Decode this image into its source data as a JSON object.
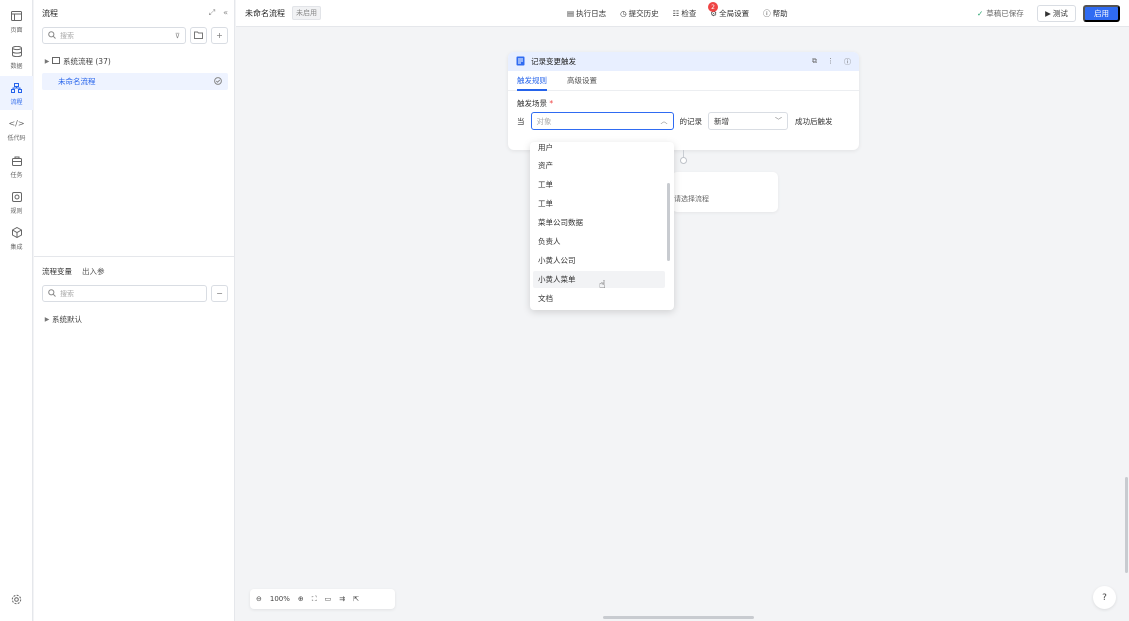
{
  "rail": {
    "items": [
      {
        "label": "页面",
        "icon": "page-icon"
      },
      {
        "label": "数据",
        "icon": "database-icon"
      },
      {
        "label": "流程",
        "icon": "flow-icon",
        "active": true
      },
      {
        "label": "低代码",
        "icon": "code-icon"
      },
      {
        "label": "任务",
        "icon": "task-icon"
      },
      {
        "label": "规则",
        "icon": "rule-icon"
      },
      {
        "label": "集成",
        "icon": "integration-icon"
      }
    ],
    "settings_icon": "settings-icon"
  },
  "panel": {
    "title": "流程",
    "search_placeholder": "搜索",
    "tree": [
      {
        "label": "系统流程 (37)"
      },
      {
        "label": "未命名流程"
      }
    ],
    "var_tabs": [
      "流程变量",
      "出入参"
    ],
    "var_search_placeholder": "搜索",
    "var_tree": [
      {
        "label": "系统默认"
      }
    ]
  },
  "topbar": {
    "title": "未命名流程",
    "status": "未启用",
    "menu": [
      "执行日志",
      "提交历史",
      "检查",
      "全局设置",
      "帮助"
    ],
    "check_badge": "2",
    "saved": "草稿已保存",
    "test_label": "测试",
    "apply_label": "启用"
  },
  "card": {
    "title": "记录变更触发",
    "tabs": [
      "触发规则",
      "高级设置"
    ],
    "field_label": "触发场景",
    "when": "当",
    "object_placeholder": "对象",
    "records_of": "的记录",
    "action_value": "新增",
    "after": "成功后触发"
  },
  "node2": {
    "text": "请选择流程"
  },
  "dropdown": {
    "items": [
      "用户",
      "资产",
      "工单",
      "工单",
      "菜单公司数据",
      "负责人",
      "小黄人公司",
      "小黄人菜单",
      "文档"
    ],
    "hover_index": 7
  },
  "zoom": {
    "level": "100%"
  },
  "help_label": "?"
}
